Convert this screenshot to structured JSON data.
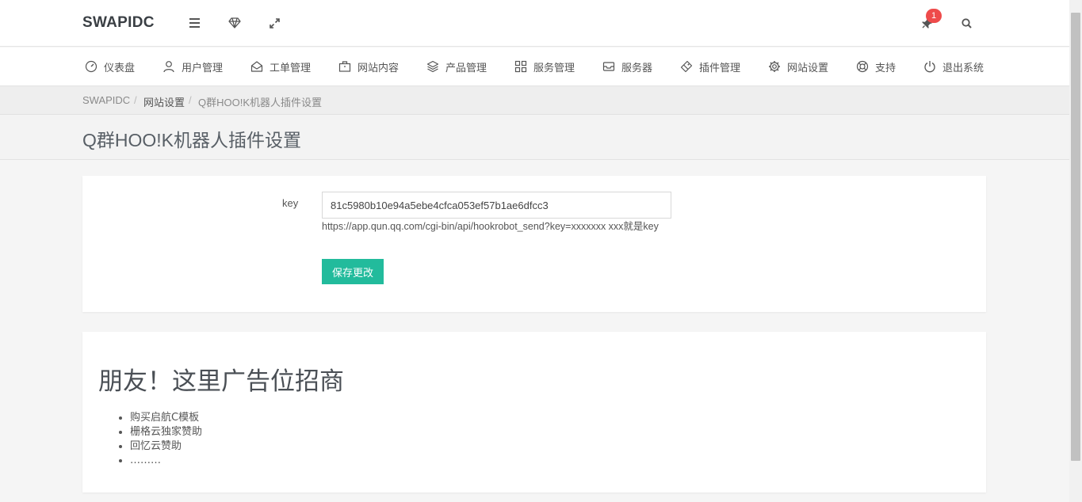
{
  "header": {
    "brand": "SWAPIDC",
    "notification_count": "1",
    "icons": [
      "menu-icon",
      "diamond-icon",
      "expand-icon",
      "pin-icon",
      "search-icon"
    ]
  },
  "nav": {
    "items": [
      {
        "label": "仪表盘",
        "icon": "dashboard-icon"
      },
      {
        "label": "用户管理",
        "icon": "user-icon"
      },
      {
        "label": "工单管理",
        "icon": "inbox-icon"
      },
      {
        "label": "网站内容",
        "icon": "briefcase-icon"
      },
      {
        "label": "产品管理",
        "icon": "layers-icon"
      },
      {
        "label": "服务管理",
        "icon": "grid-icon"
      },
      {
        "label": "服务器",
        "icon": "server-tray-icon"
      },
      {
        "label": "插件管理",
        "icon": "plugin-icon"
      },
      {
        "label": "网站设置",
        "icon": "gear-icon"
      },
      {
        "label": "支持",
        "icon": "lifebuoy-icon"
      },
      {
        "label": "退出系统",
        "icon": "power-icon"
      }
    ]
  },
  "breadcrumb": [
    "SWAPIDC",
    "网站设置",
    "Q群HOO!K机器人插件设置"
  ],
  "page": {
    "title": "Q群HOO!K机器人插件设置"
  },
  "form": {
    "key_label": "key",
    "key_value": "81c5980b10e94a5ebe4cfca053ef57b1ae6dfcc3",
    "help_text": "https://app.qun.qq.com/cgi-bin/api/hookrobot_send?key=xxxxxxx xxx就是key",
    "save_label": "保存更改"
  },
  "ad": {
    "title": "朋友！这里广告位招商",
    "items": [
      "购买启航C模板",
      "栅格云独家赞助",
      "回忆云赞助",
      "………"
    ]
  },
  "colors": {
    "accent": "#22bb9c",
    "badge": "#ee4b4b",
    "brand_text": "#3a3f44"
  }
}
